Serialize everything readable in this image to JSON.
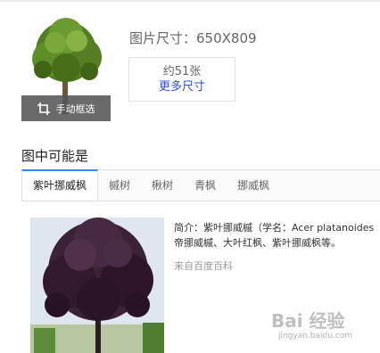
{
  "image_info": {
    "size_label": "图片尺寸：650X809",
    "count_label": "约51张",
    "more_sizes_link": "更多尺寸",
    "crop_button_label": "手动框选"
  },
  "section": {
    "title": "图中可能是"
  },
  "tabs": [
    {
      "label": "紫叶挪威枫",
      "active": true
    },
    {
      "label": "槭树",
      "active": false
    },
    {
      "label": "楸树",
      "active": false
    },
    {
      "label": "青枫",
      "active": false
    },
    {
      "label": "挪威枫",
      "active": false
    }
  ],
  "result": {
    "description_line1": "简介：紫叶挪威槭（学名：Acer platanoides",
    "description_line2": "帝挪威槭、大叶红枫、紫叶挪威枫等。",
    "source": "来自百度百科"
  },
  "watermark": {
    "text": "Bai 经验",
    "sub": "jingyan.baidu.com"
  },
  "icons": {
    "crop": "crop-icon"
  },
  "colors": {
    "accent": "#3388ff",
    "link": "#2a4fd8"
  }
}
